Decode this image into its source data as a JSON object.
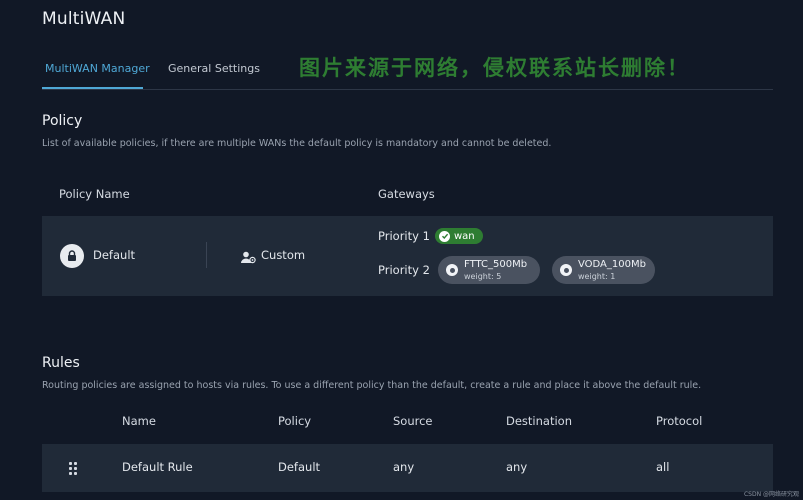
{
  "app": {
    "title": "MultiWAN"
  },
  "tabs": [
    {
      "label": "MultiWAN Manager"
    },
    {
      "label": "General Settings"
    }
  ],
  "watermark": "图片来源于网络，侵权联系站长删除！",
  "policy": {
    "title": "Policy",
    "description": "List of available policies, if there are multiple WANs the default policy is mandatory and cannot be deleted.",
    "headers": {
      "name": "Policy Name",
      "gateways": "Gateways"
    },
    "row": {
      "name": "Default",
      "mode": "Custom",
      "lock_icon": "lock-icon",
      "mode_icon": "user-settings-icon",
      "priority1": {
        "label": "Priority 1",
        "gateway": "wan",
        "badge_color": "#2e7d32"
      },
      "priority2": {
        "label": "Priority 2",
        "gateways": [
          {
            "name": "FTTC_500Mb",
            "weight": "weight: 5"
          },
          {
            "name": "VODA_100Mb",
            "weight": "weight: 1"
          }
        ]
      }
    }
  },
  "rules": {
    "title": "Rules",
    "description": "Routing policies are assigned to hosts via rules. To use a different policy than the default, create a rule and place it above the default rule.",
    "headers": {
      "name": "Name",
      "policy": "Policy",
      "source": "Source",
      "destination": "Destination",
      "protocol": "Protocol"
    },
    "rows": [
      {
        "name": "Default Rule",
        "policy": "Default",
        "source": "any",
        "destination": "any",
        "protocol": "all",
        "handle_icon": "drag-handle-icon"
      }
    ]
  },
  "corner_mark": "CSDN @网络研究观",
  "colors": {
    "background": "#111826",
    "row_background": "#202a38",
    "accent": "#4fa8d6",
    "success": "#2e7d32",
    "pill": "#4a5260"
  }
}
